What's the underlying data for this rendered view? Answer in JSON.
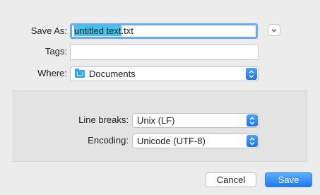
{
  "form": {
    "save_as_label": "Save As:",
    "filename_selected": "untitled text",
    "filename_extension": ".txt",
    "tags_label": "Tags:",
    "tags_value": "",
    "where_label": "Where:",
    "where_value": "Documents",
    "where_icon": "folder-icon"
  },
  "options": {
    "line_breaks_label": "Line breaks:",
    "line_breaks_value": "Unix (LF)",
    "encoding_label": "Encoding:",
    "encoding_value": "Unicode (UTF-8)"
  },
  "buttons": {
    "cancel_label": "Cancel",
    "save_label": "Save"
  },
  "colors": {
    "accent": "#1f78f3",
    "selection": "#3fc5ee",
    "focus_ring": "#6aa9f3"
  }
}
